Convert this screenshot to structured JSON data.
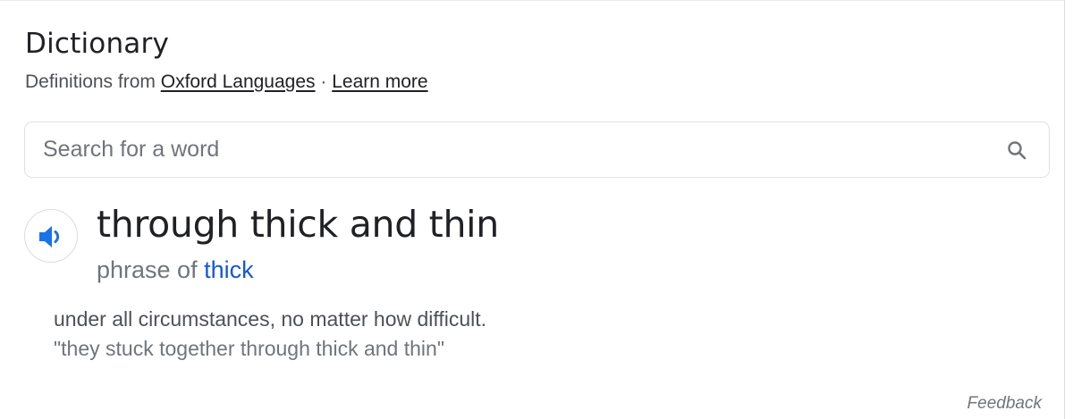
{
  "dictionary": {
    "title": "Dictionary",
    "source_prefix": "Definitions from",
    "source_link": "Oxford Languages",
    "separator": "·",
    "learn_more": "Learn more"
  },
  "search": {
    "placeholder": "Search for a word",
    "value": "",
    "icon": "search-icon"
  },
  "entry": {
    "speaker_icon": "speaker-icon",
    "headword": "through thick and thin",
    "phrase_prefix": "phrase of",
    "phrase_link": "thick",
    "definition": "under all circumstances, no matter how difficult.",
    "example": "\"they stuck together through thick and thin\""
  },
  "footer": {
    "feedback": "Feedback"
  },
  "colors": {
    "link_blue": "#1558d6",
    "speaker_blue": "#1a73e8",
    "text_primary": "#202124",
    "text_secondary": "#70757a"
  }
}
